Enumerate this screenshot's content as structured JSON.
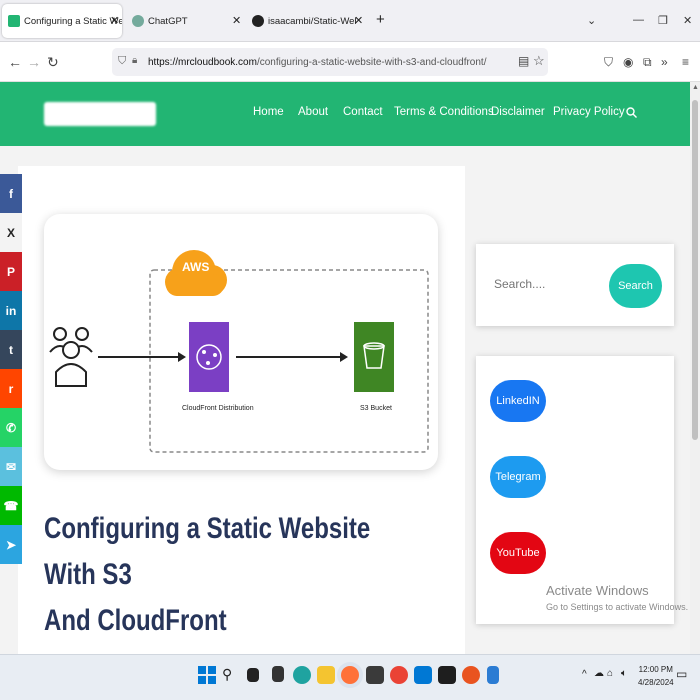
{
  "browser": {
    "tabs": [
      {
        "label": "Configuring a Static Website W",
        "active": true
      },
      {
        "label": "ChatGPT",
        "active": false
      },
      {
        "label": "isaacambi/Static-Website",
        "active": false
      }
    ],
    "new_tab": "+",
    "url_host": "https://mrcloudbook.com",
    "url_path": "/configuring-a-static-website-with-s3-and-cloudfront/"
  },
  "site": {
    "menu": [
      "Home",
      "About",
      "Contact",
      "Terms & Conditions",
      "Disclaimer",
      "Privacy Policy"
    ],
    "search_icon": "search-icon"
  },
  "share": [
    {
      "icon": "facebook-icon",
      "glyph": "f",
      "color": "#3b5998"
    },
    {
      "icon": "x-icon",
      "glyph": "X",
      "color": "#f3f3f3"
    },
    {
      "icon": "pinterest-icon",
      "glyph": "P",
      "color": "#cb2027"
    },
    {
      "icon": "linkedin-icon",
      "glyph": "in",
      "color": "#0e76a8"
    },
    {
      "icon": "tumblr-icon",
      "glyph": "t",
      "color": "#35465c"
    },
    {
      "icon": "reddit-icon",
      "glyph": "r",
      "color": "#ff4500"
    },
    {
      "icon": "whatsapp-icon",
      "glyph": "✆",
      "color": "#25d366"
    },
    {
      "icon": "email-icon",
      "glyph": "✉",
      "color": "#5bc0de"
    },
    {
      "icon": "phone-icon",
      "glyph": "☎",
      "color": "#00b900"
    },
    {
      "icon": "telegram-icon",
      "glyph": "➤",
      "color": "#2ca5e0"
    }
  ],
  "diagram": {
    "cloud_label": "AWS",
    "cloudfront_label": "CloudFront Distribution",
    "s3_label": "S3 Bucket"
  },
  "article": {
    "title_line1": "Configuring a Static Website With S3",
    "title_line2": "And CloudFront"
  },
  "sidebar": {
    "search_placeholder": "Search....",
    "search_button": "Search",
    "social": [
      {
        "label": "LinkedIN",
        "color": "#1877f2"
      },
      {
        "label": "Telegram",
        "color": "#1d9bf0"
      },
      {
        "label": "YouTube",
        "color": "#e30613"
      }
    ]
  },
  "watermark": {
    "line1": "Activate Windows",
    "line2": "Go to Settings to activate Windows."
  },
  "taskbar": {
    "time": "12:00 PM",
    "date": "4/28/2024"
  }
}
